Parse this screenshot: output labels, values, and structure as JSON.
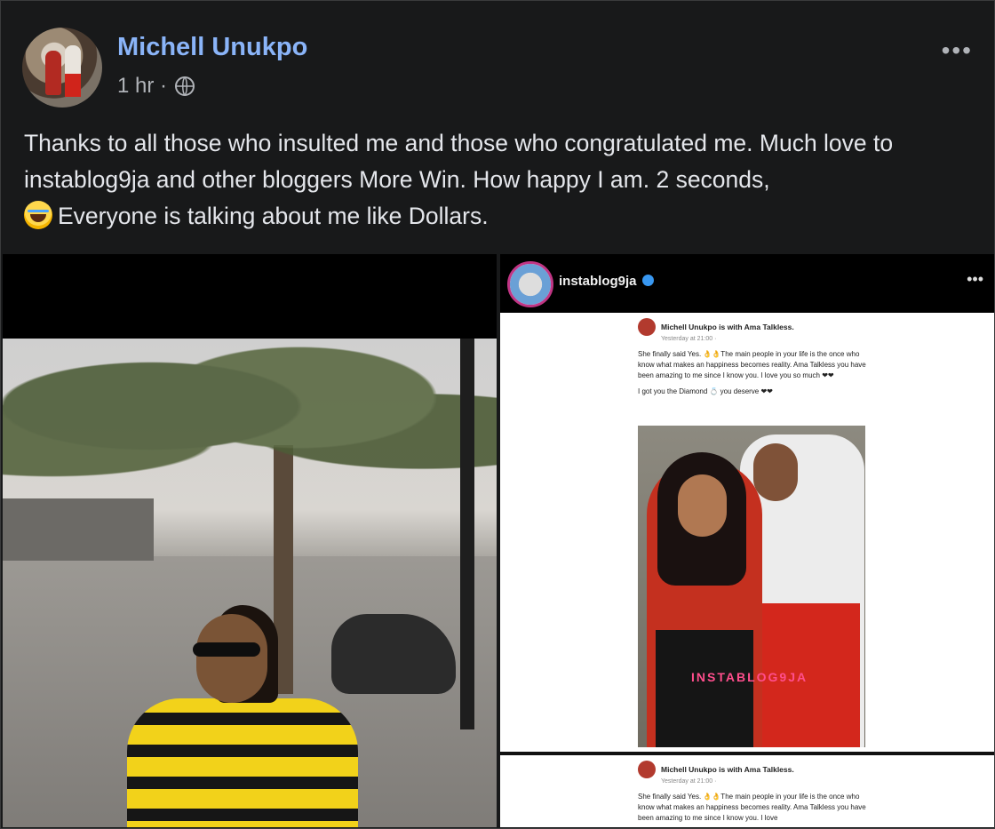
{
  "post": {
    "author": "Michell Unukpo",
    "time": "1 hr ·",
    "more": "•••",
    "text_main": "Thanks to all those who insulted me and those who congratulated me. Much love to instablog9ja and other bloggers More Win. How happy I am. 2 seconds,",
    "text_end": "Everyone is talking about me like Dollars."
  },
  "instagram": {
    "account": "instablog9ja",
    "more": "•••",
    "watermark": "INSTABLOG9JA"
  },
  "fb_screenshot": {
    "author_line": "Michell Unukpo is with Ama Talkless.",
    "time": "Yesterday at 21:00 ·",
    "para1": "She finally said Yes. 👌👌The main people in your life is the once who know what makes an happiness becomes reality. Ama Talkless you have been amazing to me since I know you. I love you so much ❤❤",
    "para2": "I got you the Diamond 💍 you deserve ❤❤",
    "para1_cropped": "She finally said Yes. 👌👌The main people in your life is the once who know what makes an happiness becomes reality. Ama Talkless you have been amazing to me since I know you. I love"
  },
  "colors": {
    "background": "#18191a",
    "name_link": "#8ab4f8",
    "text": "#e4e6eb",
    "meta": "#b0b3b8"
  },
  "icons": [
    "globe-icon",
    "more-options-icon",
    "laughing-emoji-icon",
    "verified-badge-icon"
  ]
}
